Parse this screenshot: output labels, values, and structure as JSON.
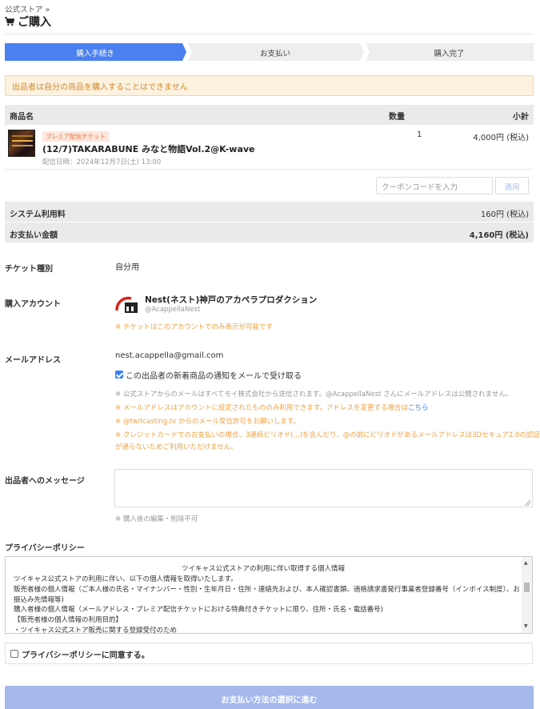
{
  "breadcrumb": "公式ストア »",
  "page_title": "ご購入",
  "steps": [
    "購入手続き",
    "お支払い",
    "購入完了"
  ],
  "alert": "出品者は自分の商品を購入することはできません",
  "table": {
    "headers": {
      "name": "商品名",
      "qty": "数量",
      "subtotal": "小計"
    },
    "item": {
      "tag": "プレミア配信チケット",
      "name": "(12/7)TAKARABUNE みなと物語Vol.2@K-wave",
      "date": "配信日時：2024年12月7日(土) 13:00",
      "qty": "1",
      "price": "4,000円 (税込)"
    }
  },
  "coupon": {
    "placeholder": "クーポンコードを入力",
    "apply": "適用"
  },
  "fees": {
    "system_label": "システム利用料",
    "system_value": "160円 (税込)",
    "total_label": "お支払い金額",
    "total_value": "4,160円 (税込)"
  },
  "ticket_type": {
    "label": "チケット種別",
    "value": "自分用"
  },
  "account": {
    "label": "購入アカウント",
    "name": "Nest(ネスト)神戸のアカペラプロダクション",
    "handle": "@AcappellaNest",
    "note": "※ チケットはこのアカウントでのみ表示が可能です"
  },
  "email": {
    "label": "メールアドレス",
    "value": "nest.acappella@gmail.com",
    "checkbox_label": "この出品者の新着商品の通知をメールで受け取る",
    "checkbox_checked": true,
    "note1": "※ 公式ストアからのメールはすべてモイ株式会社から送信されます。@AcappellaNest さんにメールアドレスは公開されません。",
    "note2": "※ メールアドレスはアカウントに設定されたもののみ利用できます。アドレスを変更する場合は",
    "note2_link": "こちら",
    "note3": "※ @twitcasting.tv からのメール受信許可をお願いします。",
    "note4a": "※ クレジットカードでのお支払いの場合、3連続ピリオド(...)を含んだり、@の前にピリオドがあるメールアドレスは3Dセキュア2.0の認証",
    "note4b": "が通らないためご利用いただけません。"
  },
  "message": {
    "label": "出品者へのメッセージ",
    "note": "※ 購入後の編集・削除不可"
  },
  "privacy": {
    "heading": "プライバシーポリシー",
    "title": "ツイキャス公式ストアの利用に伴い取得する個人情報",
    "lines": [
      "ツイキャス公式ストアの利用に伴い、以下の個人情報を取得いたします。",
      "販売者様の個人情報（ご本人様の氏名・マイナンバー・性別・生年月日・住所・連絡先および、本人確認書類、適格請求書発行事業者登録番号（インボイス制度）、お",
      "振込み先情報等)",
      "購入者様の個人情報（メールアドレス・プレミア配信チケットにおける特典付きチケットに限り、住所・氏名・電話番号)",
      "【販売者様の個人情報の利用目的】",
      "・ツイキャス公式ストア販売に関する登録受付のため"
    ],
    "agree_label": "プライバシーポリシーに同意する。",
    "agree_checked": false
  },
  "submit": "お支払い方法の選択に進む",
  "colors": {
    "step_active": "#4a80f0",
    "step_inactive": "#eeeeee",
    "alert_bg": "#fdf2e0",
    "alert_text": "#d08a2a",
    "note_orange": "#f0a040",
    "link": "#3b82f6",
    "submit_bg": "#a6b9ec"
  },
  "icons": [
    "cart-icon",
    "account-logo-icon",
    "checkbox-icon",
    "scroll-up-icon",
    "scroll-down-icon"
  ]
}
